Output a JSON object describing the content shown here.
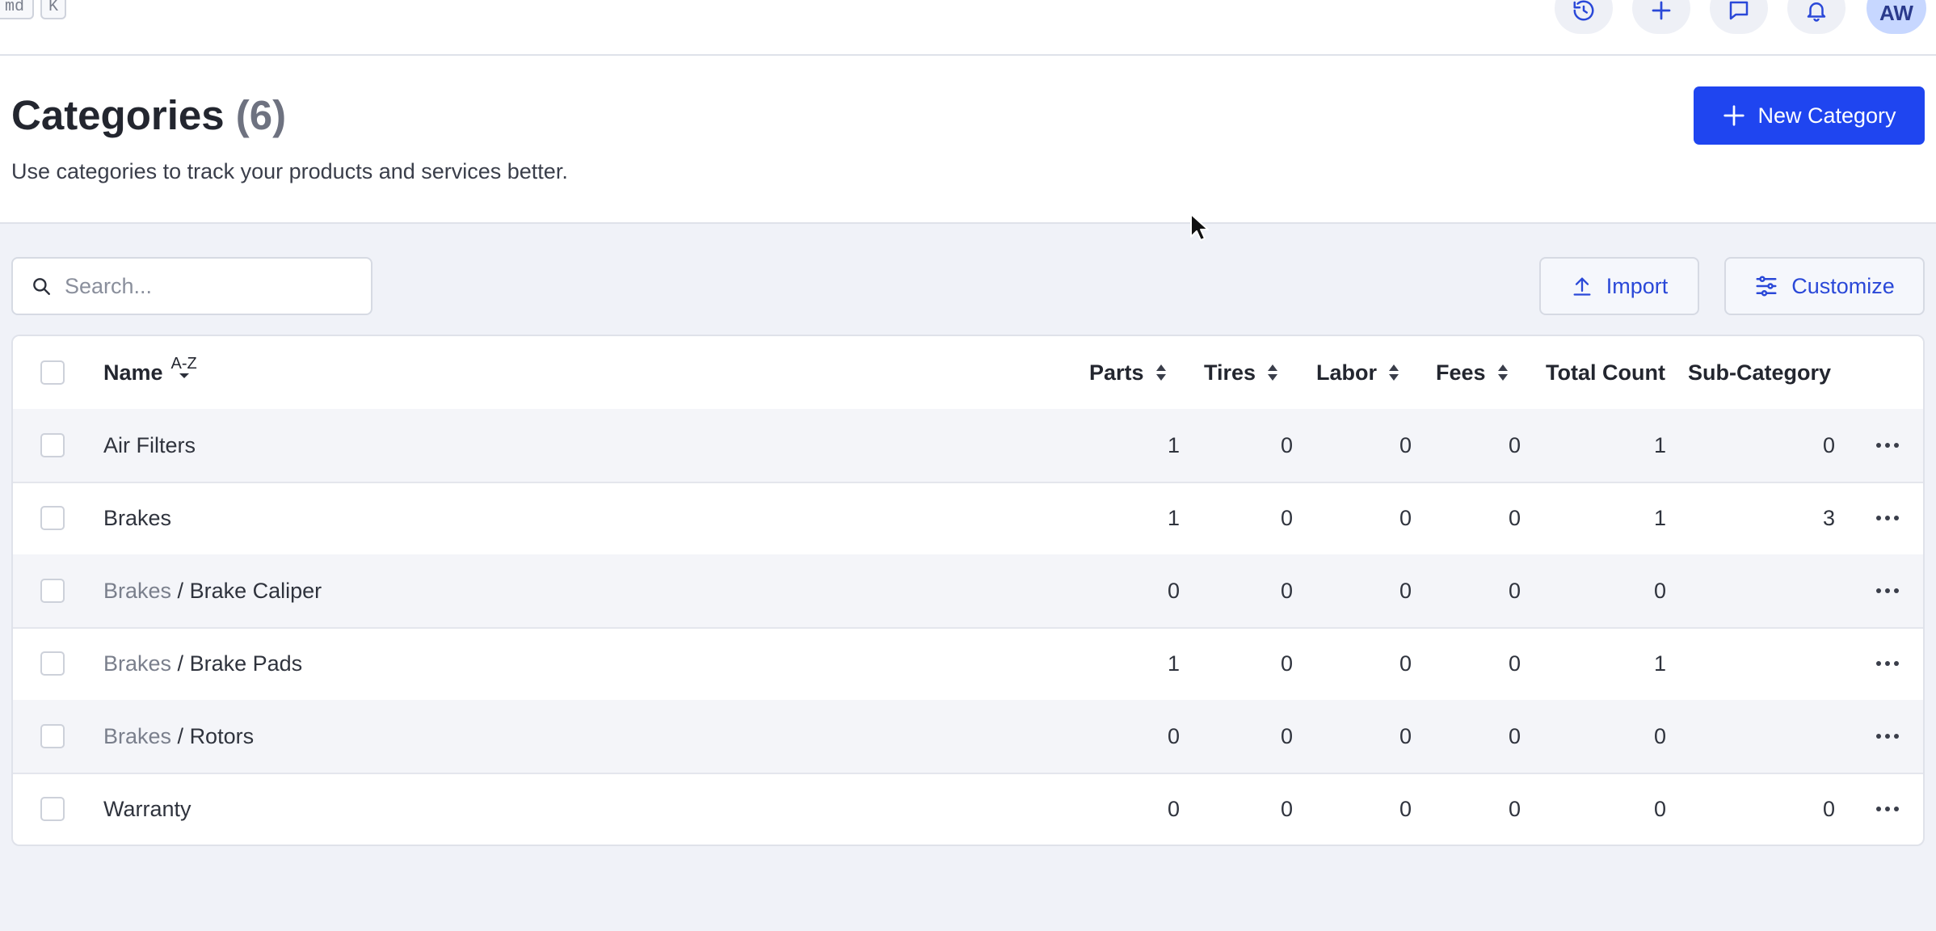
{
  "topbar": {
    "kbd_cmd": "md",
    "kbd_k": "K",
    "avatar_initials": "AW"
  },
  "header": {
    "title": "Categories",
    "count": "(6)",
    "subtitle": "Use categories to track your products and services better.",
    "new_button_label": "New Category"
  },
  "toolbar": {
    "search_placeholder": "Search...",
    "import_label": "Import",
    "customize_label": "Customize"
  },
  "table": {
    "columns": {
      "name": "Name",
      "name_sort": "A-Z",
      "parts": "Parts",
      "tires": "Tires",
      "labor": "Labor",
      "fees": "Fees",
      "total": "Total Count",
      "sub": "Sub-Category"
    },
    "rows": [
      {
        "parent": "",
        "sep": "",
        "name": "Air Filters",
        "parts": "1",
        "tires": "0",
        "labor": "0",
        "fees": "0",
        "total": "1",
        "sub": "0"
      },
      {
        "parent": "",
        "sep": "",
        "name": "Brakes",
        "parts": "1",
        "tires": "0",
        "labor": "0",
        "fees": "0",
        "total": "1",
        "sub": "3"
      },
      {
        "parent": "Brakes",
        "sep": " / ",
        "name": "Brake Caliper",
        "parts": "0",
        "tires": "0",
        "labor": "0",
        "fees": "0",
        "total": "0",
        "sub": ""
      },
      {
        "parent": "Brakes",
        "sep": " / ",
        "name": "Brake Pads",
        "parts": "1",
        "tires": "0",
        "labor": "0",
        "fees": "0",
        "total": "1",
        "sub": ""
      },
      {
        "parent": "Brakes",
        "sep": " / ",
        "name": "Rotors",
        "parts": "0",
        "tires": "0",
        "labor": "0",
        "fees": "0",
        "total": "0",
        "sub": ""
      },
      {
        "parent": "",
        "sep": "",
        "name": "Warranty",
        "parts": "0",
        "tires": "0",
        "labor": "0",
        "fees": "0",
        "total": "0",
        "sub": "0"
      }
    ]
  },
  "colors": {
    "primary": "#1f45f0",
    "link": "#2a48d8",
    "page_bg": "#f0f2f8"
  }
}
